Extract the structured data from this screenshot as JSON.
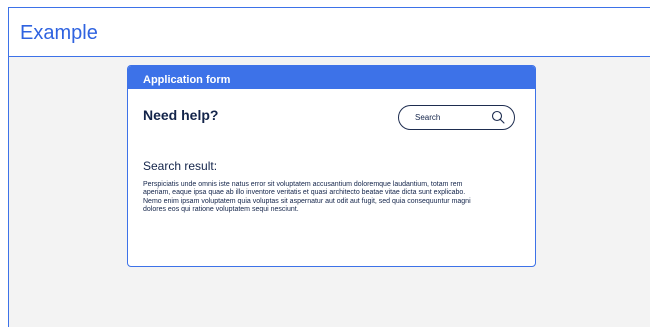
{
  "example": {
    "title": "Example"
  },
  "form": {
    "header_title": "Application form",
    "help_title": "Need help?",
    "search": {
      "placeholder": "Search",
      "value": ""
    },
    "result_title": "Search result:",
    "result_text": "Perspiciatis unde omnis iste natus error sit voluptatem accusantium doloremque laudantium, totam rem aperiam, eaque ipsa quae ab illo inventore veritatis et quasi architecto beatae vitae dicta sunt explicabo. Nemo enim ipsam voluptatem quia voluptas sit aspernatur aut odit aut fugit, sed quia consequuntur magni dolores eos qui ratione voluptatem sequi nesciunt."
  },
  "colors": {
    "accent": "#3d72e8",
    "text_dark": "#13244a",
    "background": "#f3f3f3"
  },
  "icons": {
    "search": "search-icon"
  }
}
